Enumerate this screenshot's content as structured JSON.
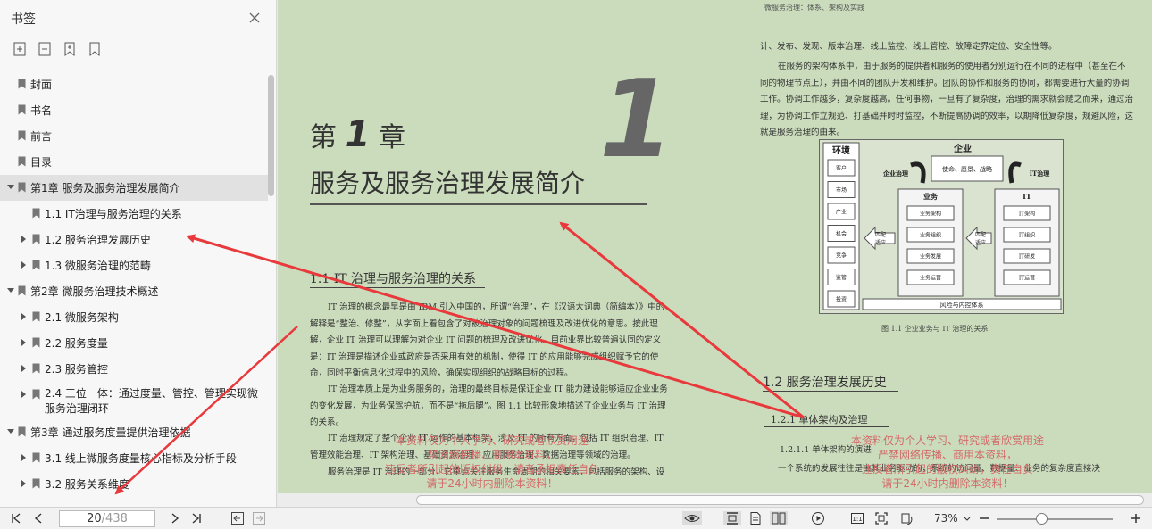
{
  "sidebar": {
    "title": "书签",
    "items": [
      {
        "label": "封面",
        "level": 0,
        "expander": "none"
      },
      {
        "label": "书名",
        "level": 0,
        "expander": "none"
      },
      {
        "label": "前言",
        "level": 0,
        "expander": "none"
      },
      {
        "label": "目录",
        "level": 0,
        "expander": "none"
      },
      {
        "label": "第1章 服务及服务治理发展简介",
        "level": 0,
        "expander": "down",
        "active": true
      },
      {
        "label": "1.1  IT治理与服务治理的关系",
        "level": 1,
        "expander": "none"
      },
      {
        "label": "1.2  服务治理发展历史",
        "level": 1,
        "expander": "right"
      },
      {
        "label": "1.3  微服务治理的范畴",
        "level": 1,
        "expander": "right"
      },
      {
        "label": "第2章 微服务治理技术概述",
        "level": 0,
        "expander": "down"
      },
      {
        "label": "2.1  微服务架构",
        "level": 1,
        "expander": "right"
      },
      {
        "label": "2.2  服务度量",
        "level": 1,
        "expander": "right"
      },
      {
        "label": "2.3  服务管控",
        "level": 1,
        "expander": "right"
      },
      {
        "label": "2.4  三位一体：通过度量、管控、管理实现微服务治理闭环",
        "level": 1,
        "expander": "right",
        "two_line": true
      },
      {
        "label": "第3章 通过服务度量提供治理依据",
        "level": 0,
        "expander": "down"
      },
      {
        "label": "3.1  线上微服务度量核心指标及分析手段",
        "level": 1,
        "expander": "right"
      },
      {
        "label": "3.2  服务关系维度",
        "level": 1,
        "expander": "right"
      }
    ]
  },
  "page": {
    "running_head": "微服务治理：体系、架构及实践",
    "chapter_prefix": "第",
    "chapter_number": "1",
    "chapter_suffix": "章",
    "big_number": "1",
    "chapter_title": "服务及服务治理发展简介",
    "section_1_1": "1.1    IT 治理与服务治理的关系",
    "left_paragraphs": [
      "IT 治理的概念最早是由 IBM 引入中国的，所谓“治理”，在《汉语大词典（简编本）》中的解释是“整治、修整”，从字面上看包含了对被治理对象的问题梳理及改进优化的意思。按此理解，企业 IT 治理可以理解为对企业 IT 问题的梳理及改进优化。目前业界比较普遍认同的定义是：IT 治理是描述企业或政府是否采用有效的机制，使得 IT 的应用能够完成组织赋予它的使命，同时平衡信息化过程中的风险，确保实现组织的战略目标的过程。",
      "IT 治理本质上是为业务服务的，治理的最终目标是保证企业 IT 能力建设能够适应企业业务的变化发展，为业务保驾护航，而不是“拖后腿”。图 1.1 比较形象地描述了企业业务与 IT 治理的关系。",
      "IT 治理规定了整个企业 IT 运作的基本框架，涉及 IT 的所有方面，包括 IT 组织治理、IT 管理效能治理、IT 架构治理、基础资源治理、应用服务治理、数据治理等领域的治理。",
      "服务治理是 IT 治理的一部分，它重点关注服务生命周期的相关要素，包括服务的架构、设"
    ],
    "right_paragraphs": [
      "计、发布、发现、版本治理、线上监控、线上管控、故障定界定位、安全性等。",
      "在服务的架构体系中，由于服务的提供者和服务的使用者分别运行在不同的进程中（甚至在不同的物理节点上），并由不同的团队开发和维护。团队的协作和服务的协同，都需要进行大量的协调工作。协调工作越多，复杂度越高。任何事物，一旦有了复杂度，治理的需求就会随之而来，通过治理，为协调工作立规范、打基础并时时监控，不断提高协调的效率，以期降低复杂度，规避风险，这就是服务治理的由来。"
    ],
    "figure": {
      "env_title": "环境",
      "env_items": [
        "客户",
        "市场",
        "产业",
        "机会",
        "竞争",
        "监管",
        "投资"
      ],
      "enterprise_title": "企业",
      "mission": "使命、愿景、战略",
      "enterprise_gov": "企业治理",
      "it_gov": "IT治理",
      "biz_title": "业务",
      "biz_items": [
        "业务架构",
        "业务组织",
        "业务发展",
        "业务运营"
      ],
      "it_title": "IT",
      "it_items": [
        "IT架构",
        "IT组织",
        "IT研发",
        "IT运营"
      ],
      "match_left": "匹配\n适应",
      "match_right": "匹配\n适应",
      "risk": "风险与内控体系",
      "caption": "图 1.1    企业业务与 IT 治理的关系"
    },
    "section_1_2": "1.2    服务治理发展历史",
    "section_1_2_1": "1.2.1    单体架构及治理",
    "section_1_2_1_1": "1.2.1.1    单体架构的演进",
    "last_line": "一个系统的发展往往是由其业务驱动的，系统的访问量、数据量、业务的复杂度直接决",
    "watermark_left": "本资料仅为个人学习、研究或者欣赏用途\n禁网络传播、商用本资料，\n违反者所引起的版权纠纷，请者承担责任自负\n请于24小时内删除本资料！",
    "watermark_right": "本资料仅为个人学习、研究或者欣赏用途\n严禁网络传播、商用本资料，\n违反者所引起的版权纠纷，责任自负\n请于24小时内删除本资料！"
  },
  "toolbar": {
    "current_page": "20",
    "total_pages": "/438",
    "zoom": "73%"
  },
  "colors": {
    "page_bg": "#cbdcbc",
    "arrow": "#e8393c",
    "watermark": "#d36a6a"
  }
}
